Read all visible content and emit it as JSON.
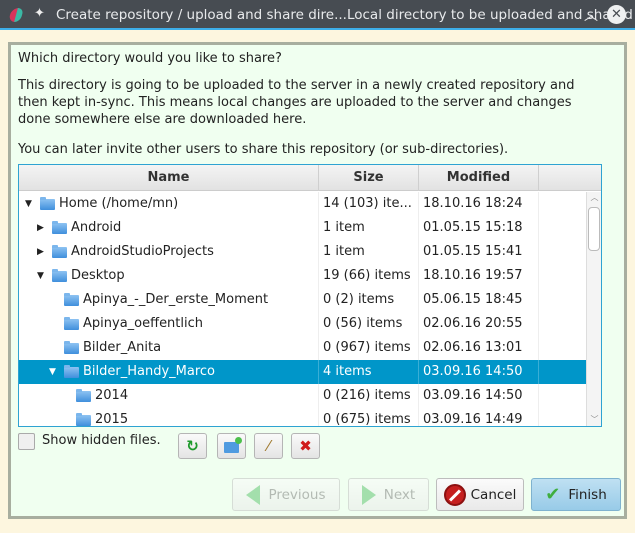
{
  "window": {
    "title": "Create repository / upload and share dire...Local directory to be uploaded and shared",
    "icons": [
      "app-logo",
      "pin-icon",
      "chevron-up-icon",
      "close-icon"
    ]
  },
  "text": {
    "question": "Which directory would you like to share?",
    "description": "This directory is going to be uploaded to the server in a newly created repository and then kept in-sync. This means local changes are uploaded to the server and changes done somewhere else are downloaded here.",
    "invite": "You can later invite other users to share this repository (or sub-directories)."
  },
  "table": {
    "columns": [
      "Name",
      "Size",
      "Modified"
    ],
    "rows": [
      {
        "name": "Home (/home/mn)",
        "size": "14 (103) ite...",
        "modified": "18.10.16 18:24",
        "level": 0,
        "expanded": true,
        "home": true
      },
      {
        "name": "Android",
        "size": "1 item",
        "modified": "01.05.15 15:18",
        "level": 1,
        "expanded": false
      },
      {
        "name": "AndroidStudioProjects",
        "size": "1 item",
        "modified": "01.05.15 15:41",
        "level": 1,
        "expanded": false
      },
      {
        "name": "Desktop",
        "size": "19 (66) items",
        "modified": "18.10.16 19:57",
        "level": 1,
        "expanded": true
      },
      {
        "name": "Apinya_-_Der_erste_Moment",
        "size": "0 (2) items",
        "modified": "05.06.15 18:45",
        "level": 2
      },
      {
        "name": "Apinya_oeffentlich",
        "size": "0 (56) items",
        "modified": "02.06.16 20:55",
        "level": 2
      },
      {
        "name": "Bilder_Anita",
        "size": "0 (967) items",
        "modified": "02.06.16 13:01",
        "level": 2
      },
      {
        "name": "Bilder_Handy_Marco",
        "size": "4 items",
        "modified": "03.09.16 14:50",
        "level": 2,
        "expanded": true,
        "selected": true
      },
      {
        "name": "2014",
        "size": "0 (216) items",
        "modified": "03.09.16 14:50",
        "level": 3
      },
      {
        "name": "2015",
        "size": "0 (675) items",
        "modified": "03.09.16 14:49",
        "level": 3
      }
    ]
  },
  "options": {
    "show_hidden": "Show hidden files.",
    "show_hidden_checked": false
  },
  "toolbar": {
    "icons": [
      "refresh-icon",
      "new-folder-icon",
      "rename-icon",
      "delete-icon"
    ]
  },
  "buttons": {
    "previous": "Previous",
    "next": "Next",
    "cancel": "Cancel",
    "finish": "Finish",
    "previous_enabled": false,
    "next_enabled": false
  },
  "colors": {
    "selection": "#0096c9",
    "panel": "#f0fff0",
    "titlebar": "#474c52"
  }
}
